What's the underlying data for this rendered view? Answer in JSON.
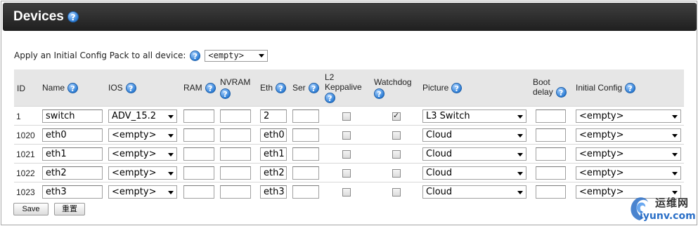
{
  "header": {
    "title": "Devices",
    "help_icon": "help-icon"
  },
  "apply": {
    "label": "Apply an Initial Config Pack to all device:",
    "selected": "<empty>"
  },
  "columns": {
    "id": "ID",
    "name": "Name",
    "ios": "IOS",
    "ram": "RAM",
    "nvram": "NVRAM",
    "eth": "Eth",
    "ser": "Ser",
    "l2_line1": "L2",
    "l2_line2": "Keppalive",
    "watchdog": "Watchdog",
    "picture": "Picture",
    "boot_line1": "Boot",
    "boot_line2": "delay",
    "initial_config": "Initial Config"
  },
  "rows": [
    {
      "id": "1",
      "name": "switch",
      "ios": "ADV_15.2",
      "ram": "",
      "nvram": "",
      "eth": "2",
      "ser": "",
      "l2": false,
      "watchdog": true,
      "picture": "L3 Switch",
      "boot": "",
      "initial_config": "<empty>"
    },
    {
      "id": "1020",
      "name": "eth0",
      "ios": "<empty>",
      "ram": "",
      "nvram": "",
      "eth": "eth0",
      "ser": "",
      "l2": false,
      "watchdog": false,
      "picture": "Cloud",
      "boot": "",
      "initial_config": "<empty>"
    },
    {
      "id": "1021",
      "name": "eth1",
      "ios": "<empty>",
      "ram": "",
      "nvram": "",
      "eth": "eth1",
      "ser": "",
      "l2": false,
      "watchdog": false,
      "picture": "Cloud",
      "boot": "",
      "initial_config": "<empty>"
    },
    {
      "id": "1022",
      "name": "eth2",
      "ios": "<empty>",
      "ram": "",
      "nvram": "",
      "eth": "eth2",
      "ser": "",
      "l2": false,
      "watchdog": false,
      "picture": "Cloud",
      "boot": "",
      "initial_config": "<empty>"
    },
    {
      "id": "1023",
      "name": "eth3",
      "ios": "<empty>",
      "ram": "",
      "nvram": "",
      "eth": "eth3",
      "ser": "",
      "l2": false,
      "watchdog": false,
      "picture": "Cloud",
      "boot": "",
      "initial_config": "<empty>"
    }
  ],
  "buttons": {
    "save": "Save",
    "reset": "重置"
  },
  "watermark": {
    "top": "运维网",
    "bottom": "iyunv.com"
  }
}
